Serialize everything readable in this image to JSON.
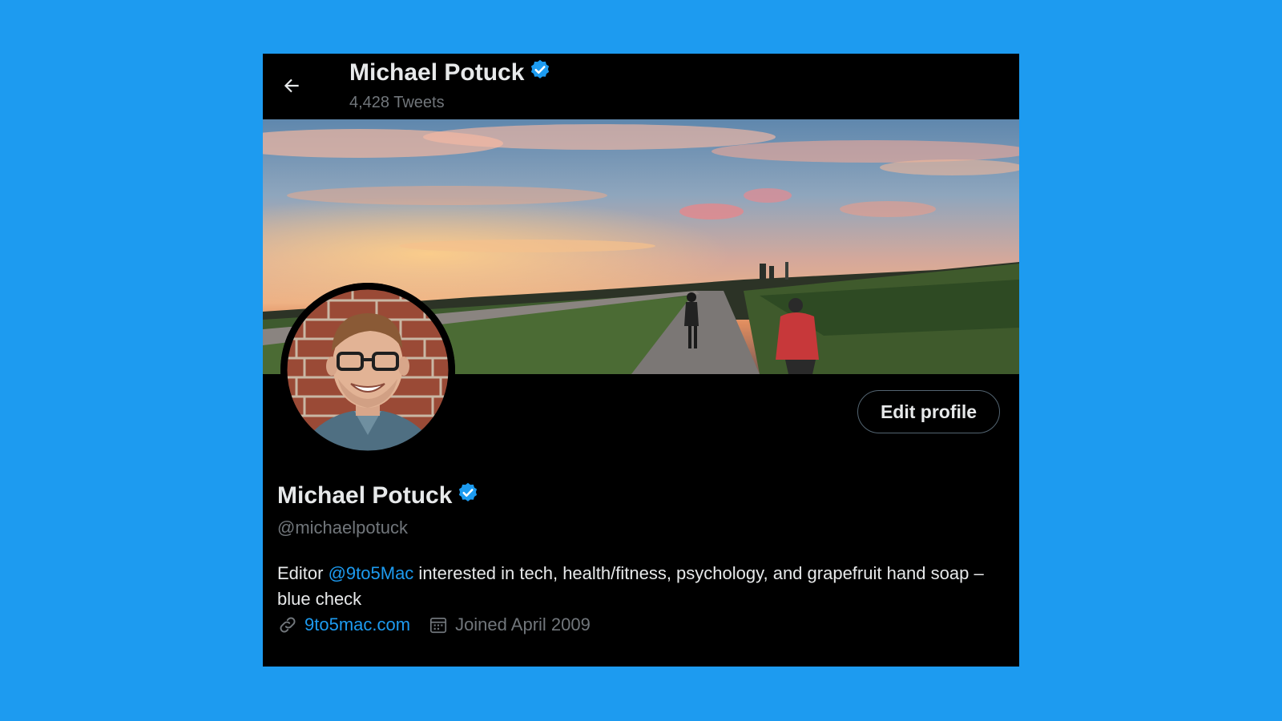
{
  "colors": {
    "page_background": "#1d9bf0",
    "card_background": "#000000",
    "primary_text": "#e7e9ea",
    "secondary_text": "#71767b",
    "accent": "#1d9bf0"
  },
  "header": {
    "back_icon": "arrow-left-icon",
    "title": "Michael Potuck",
    "verified_icon": "verified-badge-icon",
    "subtitle": "4,428 Tweets"
  },
  "profile": {
    "banner": "sunset-cycling-banner",
    "avatar": "profile-photo",
    "edit_button_label": "Edit profile",
    "name": "Michael Potuck",
    "handle": "@michaelpotuck",
    "bio": {
      "prefix": "Editor ",
      "mention": "@9to5Mac",
      "suffix": " interested in tech, health/fitness, psychology, and grapefruit hand soap – blue check"
    },
    "website_icon": "link-icon",
    "website": "9to5mac.com",
    "joined_icon": "calendar-icon",
    "joined": "Joined April 2009"
  }
}
